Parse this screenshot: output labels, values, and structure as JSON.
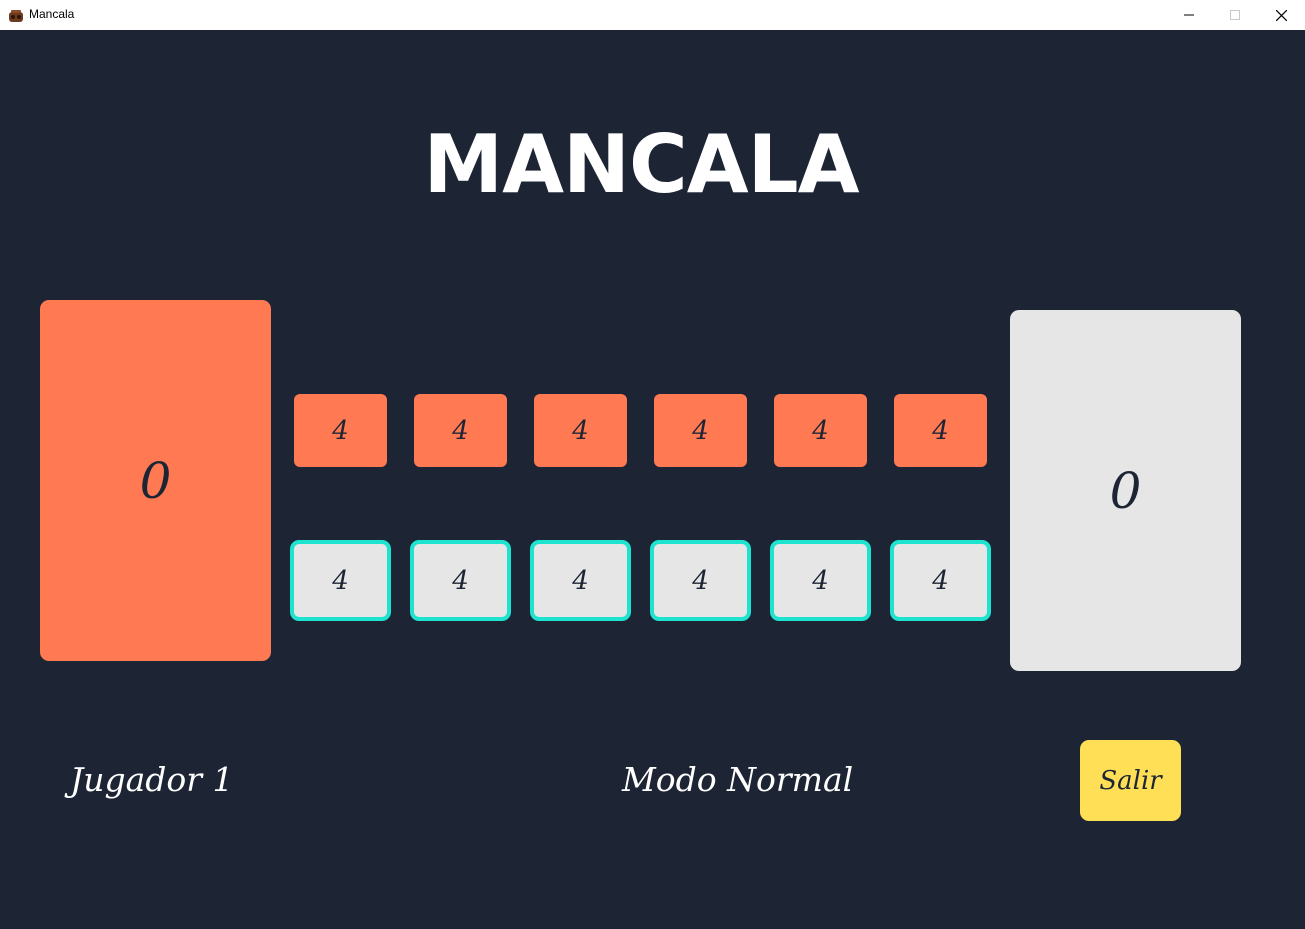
{
  "window": {
    "title": "Mancala",
    "app_icon": "mancala-board-icon",
    "controls": [
      "minimize-icon",
      "maximize-icon",
      "close-icon"
    ]
  },
  "game": {
    "title": "MANCALA",
    "store_left": "0",
    "store_right": "0",
    "top_row": [
      "4",
      "4",
      "4",
      "4",
      "4",
      "4"
    ],
    "bottom_row": [
      "4",
      "4",
      "4",
      "4",
      "4",
      "4"
    ],
    "current_player": "Jugador 1",
    "mode": "Modo Normal",
    "exit_label": "Salir"
  },
  "colors": {
    "background": "#1d2535",
    "player_one": "#ff7a52",
    "player_two": "#e6e6e6",
    "highlight": "#1ee3cf",
    "exit_button": "#ffdf55"
  }
}
